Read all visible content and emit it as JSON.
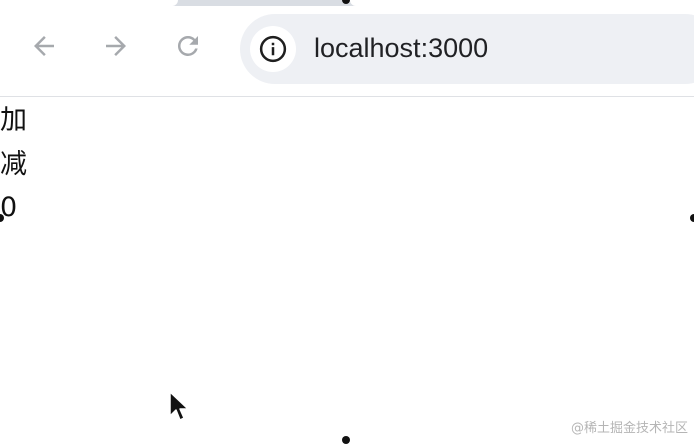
{
  "browser": {
    "url": "localhost:3000",
    "icons": {
      "back": "arrow-left-icon",
      "forward": "arrow-right-icon",
      "reload": "reload-icon",
      "site_info": "info-icon"
    }
  },
  "page": {
    "add_label": "加",
    "subtract_label": "减",
    "count": "0"
  },
  "watermark": "@稀土掘金技术社区"
}
